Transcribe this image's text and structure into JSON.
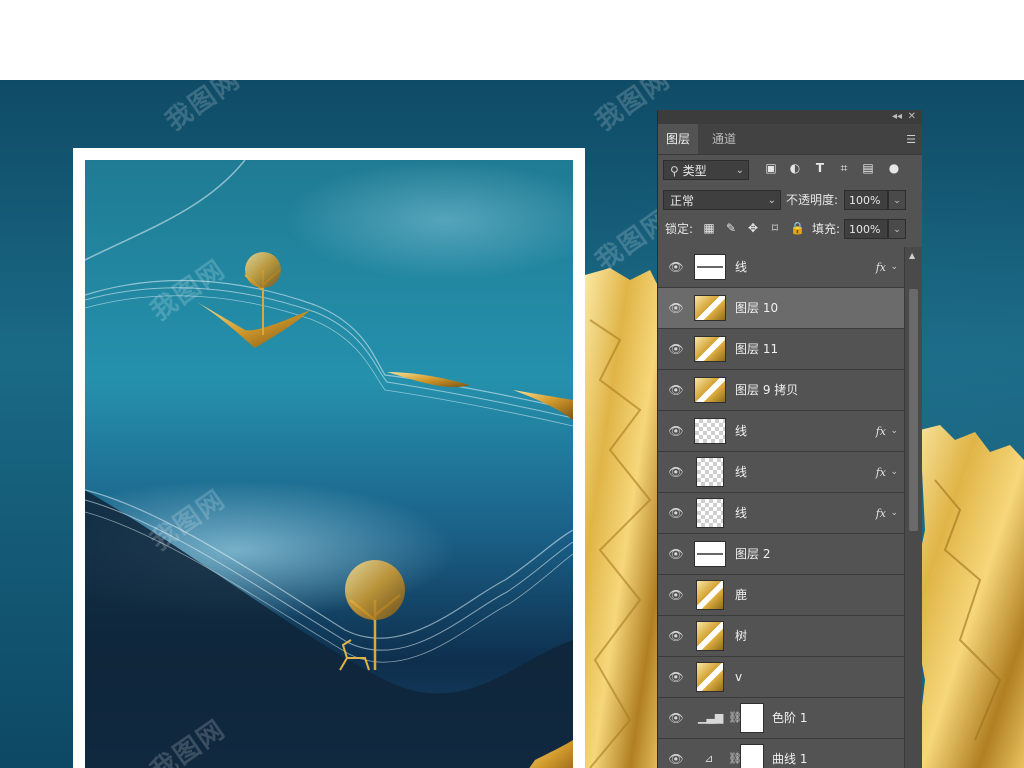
{
  "panel": {
    "tabs": [
      {
        "label": "图层"
      },
      {
        "label": "通道"
      }
    ],
    "filter": {
      "label": "类型"
    },
    "blend_mode": "正常",
    "opacity_label": "不透明度:",
    "opacity_value": "100%",
    "lock_label": "锁定:",
    "fill_label": "填充:",
    "fill_value": "100%",
    "fx_label": "fx"
  },
  "layers": [
    {
      "name": "线",
      "fx": true
    },
    {
      "name": "图层 10",
      "selected": true
    },
    {
      "name": "图层 11"
    },
    {
      "name": "图层 9 拷贝"
    },
    {
      "name": "线",
      "fx": true
    },
    {
      "name": "线",
      "fx": true
    },
    {
      "name": "线",
      "fx": true
    },
    {
      "name": "图层 2"
    },
    {
      "name": "鹿"
    },
    {
      "name": "树"
    },
    {
      "name": "v"
    },
    {
      "name": "色阶 1",
      "adjustment": "levels-icon"
    },
    {
      "name": "曲线 1",
      "adjustment": "curves-icon"
    }
  ],
  "watermark": "我图网",
  "colors": {
    "background_teal": "#0f4b66",
    "gold": "#d4a131",
    "panel_bg": "#535353",
    "selected_row": "#6b6b6b"
  }
}
